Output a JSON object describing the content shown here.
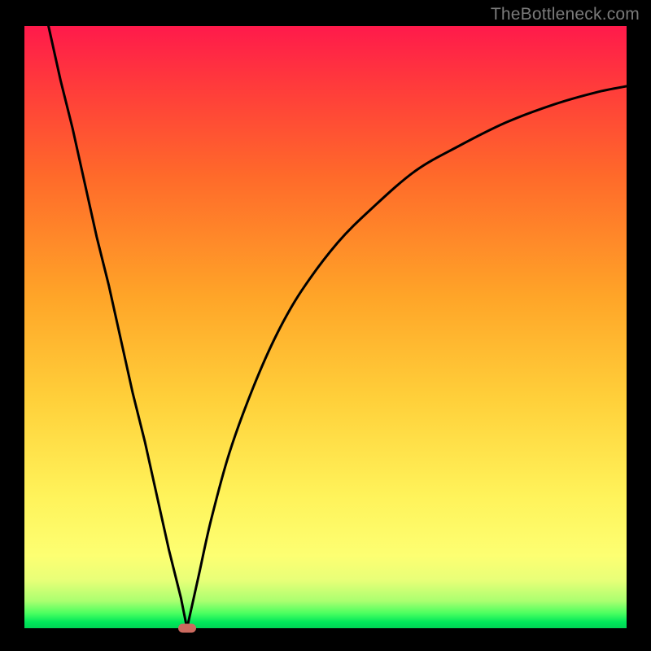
{
  "watermark": "TheBottleneck.com",
  "chart_data": {
    "type": "line",
    "title": "",
    "xlabel": "",
    "ylabel": "",
    "xlim": [
      0,
      100
    ],
    "ylim": [
      0,
      100
    ],
    "grid": false,
    "legend": false,
    "series": [
      {
        "name": "left-branch",
        "x": [
          4,
          6,
          8,
          10,
          12,
          14,
          16,
          18,
          20,
          22,
          24,
          26,
          27
        ],
        "y": [
          100,
          91,
          83,
          74,
          65,
          57,
          48,
          39,
          31,
          22,
          13,
          5,
          0
        ]
      },
      {
        "name": "right-branch",
        "x": [
          27,
          29,
          31,
          34,
          38,
          42,
          46,
          52,
          58,
          65,
          72,
          80,
          88,
          95,
          100
        ],
        "y": [
          0,
          9,
          18,
          29,
          40,
          49,
          56,
          64,
          70,
          76,
          80,
          84,
          87,
          89,
          90
        ]
      }
    ],
    "marker": {
      "x": 27,
      "y": 0,
      "color": "#cc6a5f"
    },
    "gradient_stops": [
      {
        "pos": 0,
        "color": "#ff1a4b"
      },
      {
        "pos": 25,
        "color": "#ff6a2a"
      },
      {
        "pos": 62,
        "color": "#ffd03a"
      },
      {
        "pos": 88,
        "color": "#fdff72"
      },
      {
        "pos": 100,
        "color": "#00d455"
      }
    ]
  }
}
